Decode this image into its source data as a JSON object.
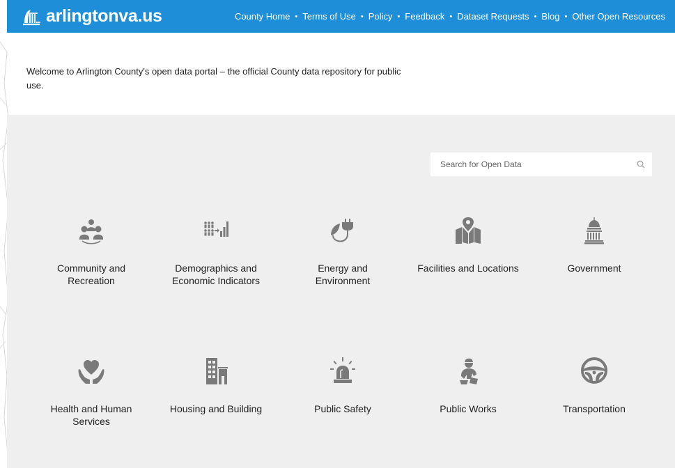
{
  "header": {
    "logo_text": "arlingtonva.us",
    "nav": [
      {
        "label": "County Home"
      },
      {
        "label": "Terms of Use"
      },
      {
        "label": "Policy"
      },
      {
        "label": "Feedback"
      },
      {
        "label": "Dataset Requests"
      },
      {
        "label": "Blog"
      },
      {
        "label": "Other Open Resources"
      }
    ],
    "separator": "•"
  },
  "intro": {
    "text": "Welcome to Arlington County's open data portal – the official County data repository for public use."
  },
  "search": {
    "placeholder": "Search for Open Data",
    "icon": "search-icon"
  },
  "categories": [
    {
      "label": "Community and Recreation",
      "icon": "community-icon"
    },
    {
      "label": "Demographics and Economic Indicators",
      "icon": "demographics-icon"
    },
    {
      "label": "Energy and Environment",
      "icon": "energy-icon"
    },
    {
      "label": "Facilities and Locations",
      "icon": "facilities-icon"
    },
    {
      "label": "Government",
      "icon": "government-icon"
    },
    {
      "label": "Health and Human Services",
      "icon": "health-icon"
    },
    {
      "label": "Housing and Building",
      "icon": "housing-icon"
    },
    {
      "label": "Public Safety",
      "icon": "public-safety-icon"
    },
    {
      "label": "Public Works",
      "icon": "public-works-icon"
    },
    {
      "label": "Transportation",
      "icon": "transportation-icon"
    }
  ],
  "colors": {
    "header_bg": "#1f8ed9",
    "panel_bg": "#efefef",
    "icon_gray": "#7a7a7a"
  }
}
